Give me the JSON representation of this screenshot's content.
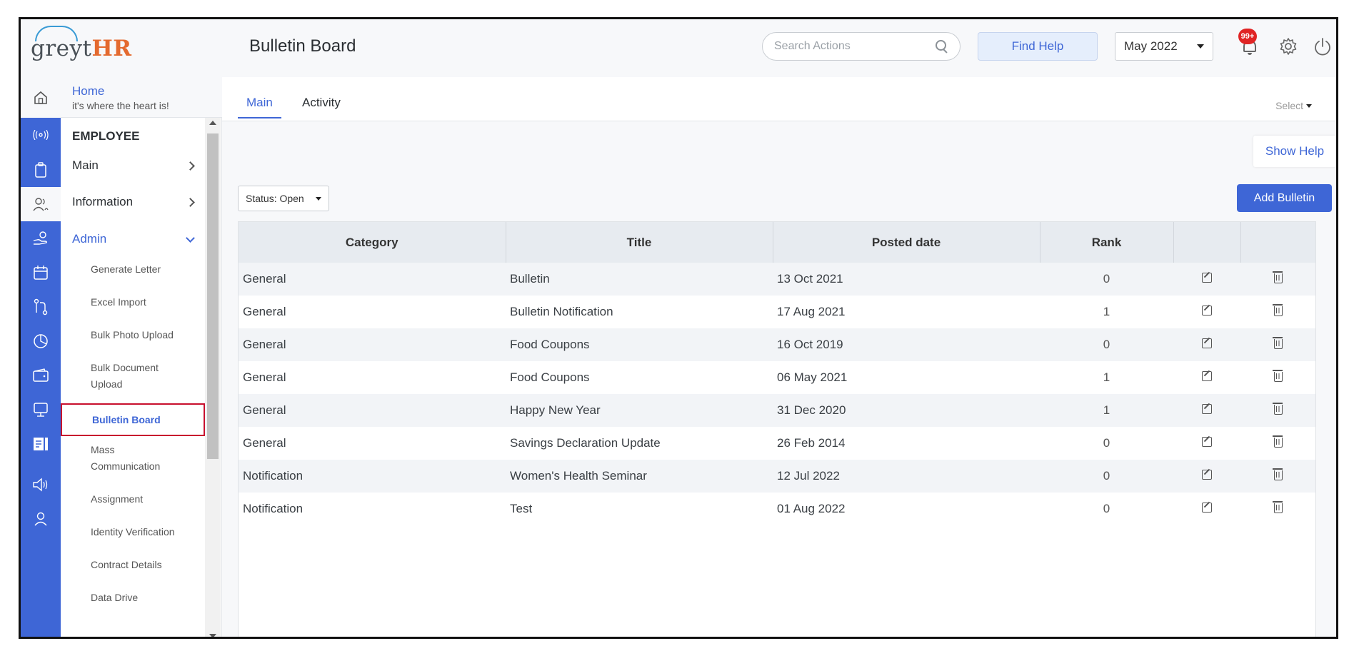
{
  "header": {
    "logo_grey": "greyt",
    "logo_hr": "HR",
    "page_title": "Bulletin Board",
    "search_placeholder": "Search Actions",
    "find_help_label": "Find Help",
    "month_value": "May 2022",
    "notification_badge": "99+"
  },
  "sidebar": {
    "home_title": "Home",
    "home_subtitle": "it's where the heart is!",
    "section_label": "EMPLOYEE",
    "main_label": "Main",
    "information_label": "Information",
    "admin_label": "Admin",
    "admin_items": [
      "Generate Letter",
      "Excel Import",
      "Bulk Photo Upload",
      "Bulk Document Upload",
      "Bulletin Board",
      "Mass Communication",
      "Assignment",
      "Identity Verification",
      "Contract Details",
      "Data Drive"
    ]
  },
  "tabs": {
    "main": "Main",
    "activity": "Activity",
    "select_label": "Select"
  },
  "toolbar": {
    "show_help_label": "Show Help",
    "status_filter": "Status: Open",
    "add_bulletin_label": "Add Bulletin"
  },
  "table": {
    "columns": [
      "Category",
      "Title",
      "Posted date",
      "Rank"
    ],
    "rows": [
      {
        "category": "General",
        "title": "Bulletin",
        "date": "13 Oct 2021",
        "rank": "0"
      },
      {
        "category": "General",
        "title": "Bulletin Notification",
        "date": "17 Aug 2021",
        "rank": "1"
      },
      {
        "category": "General",
        "title": "Food Coupons",
        "date": "16 Oct 2019",
        "rank": "0"
      },
      {
        "category": "General",
        "title": "Food Coupons",
        "date": "06 May 2021",
        "rank": "1"
      },
      {
        "category": "General",
        "title": "Happy New Year",
        "date": "31 Dec 2020",
        "rank": "1"
      },
      {
        "category": "General",
        "title": "Savings Declaration Update",
        "date": "26 Feb 2014",
        "rank": "0"
      },
      {
        "category": "Notification",
        "title": "Women's Health Seminar",
        "date": "12 Jul 2022",
        "rank": "0"
      },
      {
        "category": "Notification",
        "title": "Test",
        "date": "01 Aug 2022",
        "rank": "0"
      }
    ]
  },
  "colors": {
    "accent": "#3e66d6",
    "highlight_border": "#c8102e",
    "badge": "#e02424"
  }
}
